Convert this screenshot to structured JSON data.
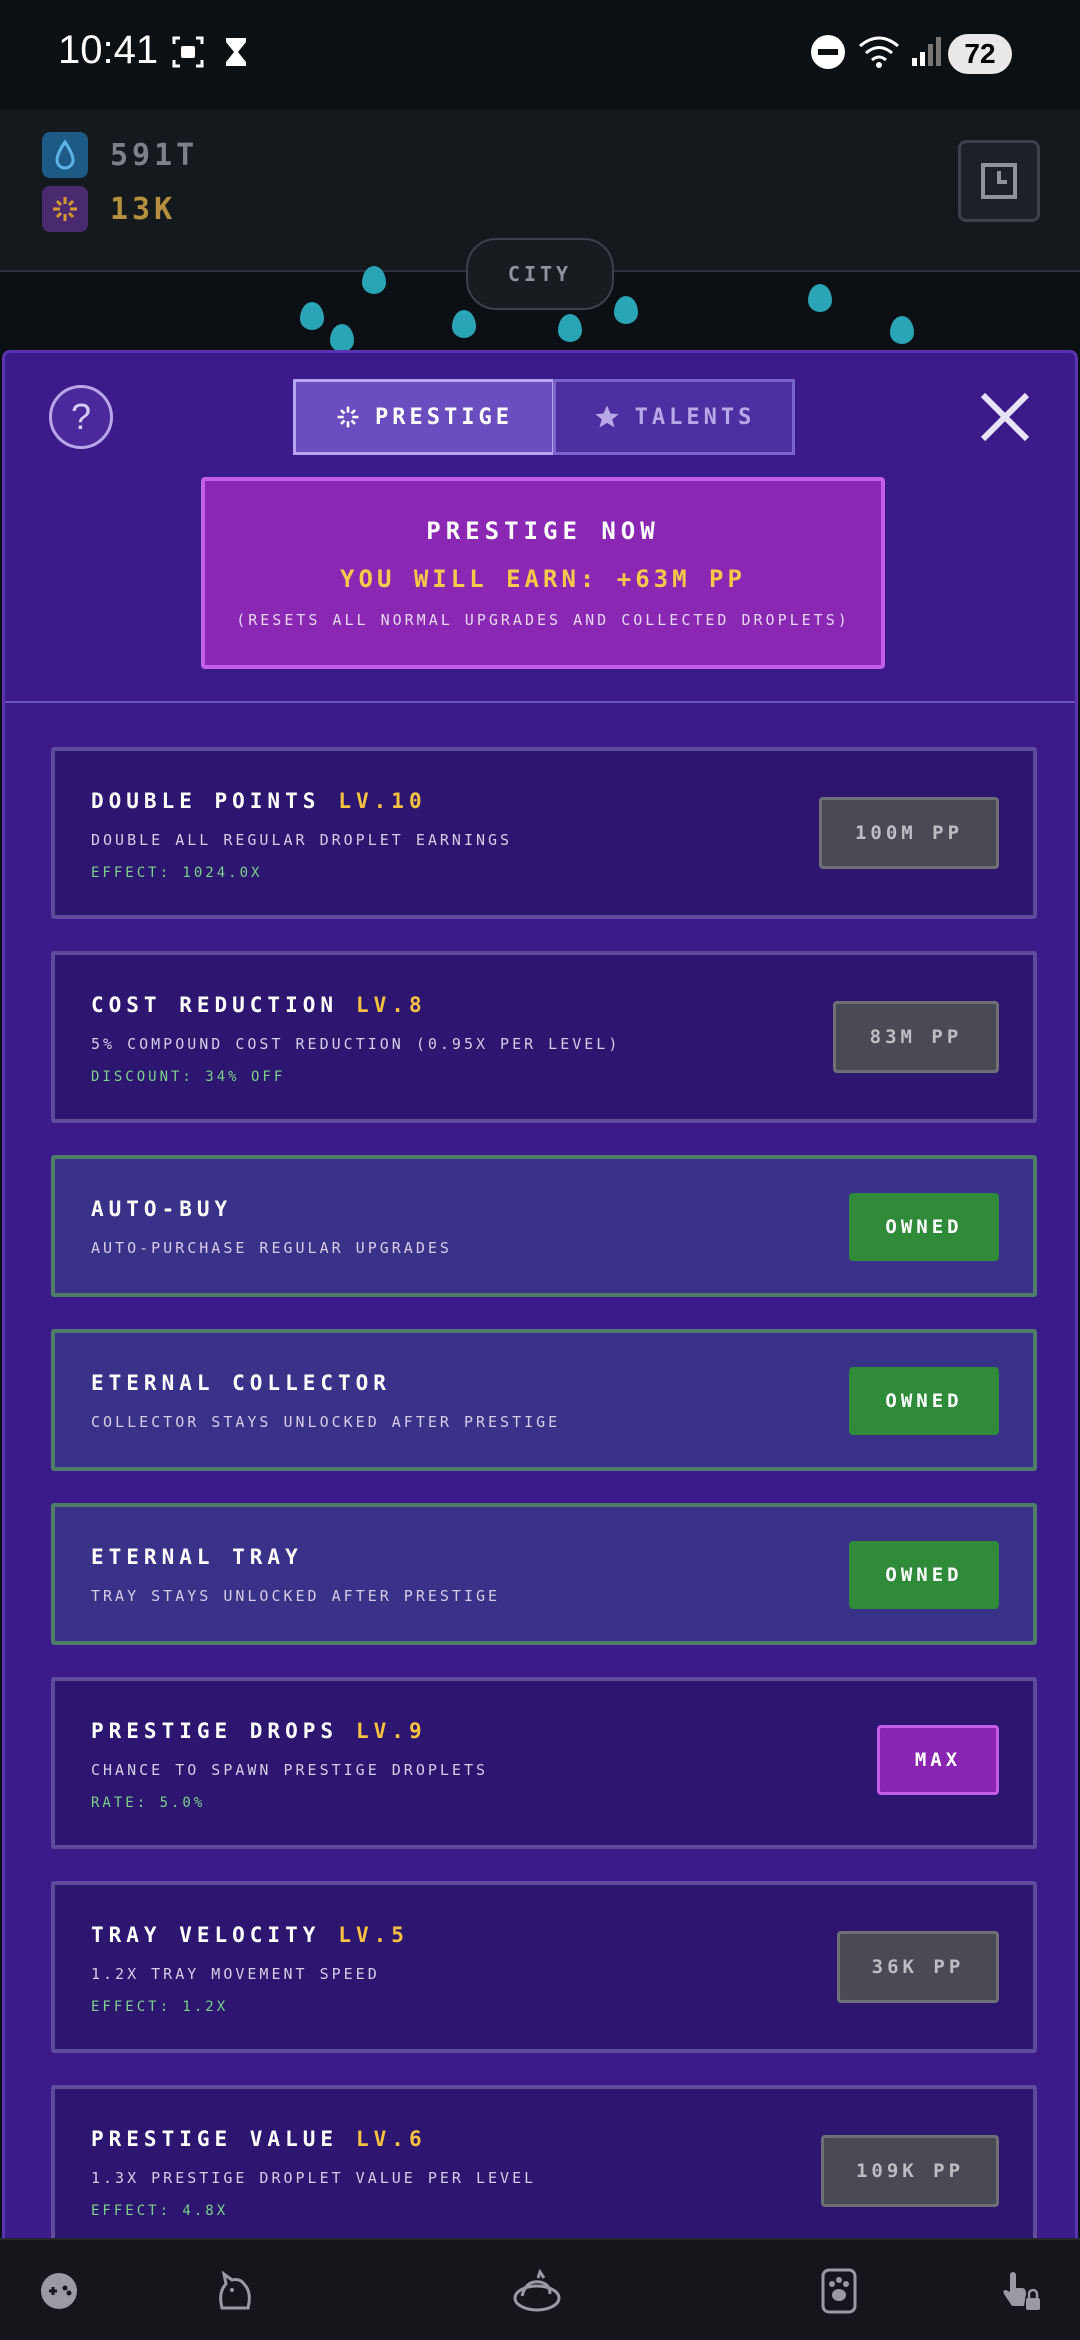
{
  "status_bar": {
    "time": "10:41",
    "battery": "72"
  },
  "header": {
    "currencies": [
      {
        "icon": "droplet-icon",
        "value": "591T",
        "color": "#7d8187"
      },
      {
        "icon": "sparkle-icon",
        "value": "13K",
        "color": "#b49040"
      }
    ],
    "location_tab": "CITY"
  },
  "panel": {
    "tabs": [
      {
        "label": "PRESTIGE",
        "icon": "sparkle-icon",
        "active": true
      },
      {
        "label": "TALENTS",
        "icon": "star-icon",
        "active": false
      }
    ],
    "prestige_box": {
      "title": "PRESTIGE NOW",
      "earn": "YOU WILL EARN: +63M PP",
      "note": "(RESETS ALL NORMAL UPGRADES AND COLLECTED DROPLETS)"
    },
    "upgrades": [
      {
        "title": "DOUBLE POINTS",
        "level": "LV.10",
        "desc": "DOUBLE ALL REGULAR DROPLET EARNINGS",
        "effect": "EFFECT: 1024.0X",
        "button": "100M PP",
        "state": "cost"
      },
      {
        "title": "COST REDUCTION",
        "level": "LV.8",
        "desc": "5% COMPOUND COST REDUCTION (0.95X PER LEVEL)",
        "effect": "DISCOUNT: 34% OFF",
        "button": "83M PP",
        "state": "cost"
      },
      {
        "title": "AUTO-BUY",
        "level": "",
        "desc": "AUTO-PURCHASE REGULAR UPGRADES",
        "effect": "",
        "button": "OWNED",
        "state": "owned"
      },
      {
        "title": "ETERNAL COLLECTOR",
        "level": "",
        "desc": "COLLECTOR STAYS UNLOCKED AFTER PRESTIGE",
        "effect": "",
        "button": "OWNED",
        "state": "owned"
      },
      {
        "title": "ETERNAL TRAY",
        "level": "",
        "desc": "TRAY STAYS UNLOCKED AFTER PRESTIGE",
        "effect": "",
        "button": "OWNED",
        "state": "owned"
      },
      {
        "title": "PRESTIGE DROPS",
        "level": "LV.9",
        "desc": "CHANCE TO SPAWN PRESTIGE DROPLETS",
        "effect": "RATE: 5.0%",
        "button": "MAX",
        "state": "max"
      },
      {
        "title": "TRAY VELOCITY",
        "level": "LV.5",
        "desc": "1.2X TRAY MOVEMENT SPEED",
        "effect": "EFFECT: 1.2X",
        "button": "36K PP",
        "state": "cost"
      },
      {
        "title": "PRESTIGE VALUE",
        "level": "LV.6",
        "desc": "1.3X PRESTIGE DROPLET VALUE PER LEVEL",
        "effect": "EFFECT: 4.8X",
        "button": "109K PP",
        "state": "cost"
      }
    ]
  },
  "bottom_nav": [
    {
      "icon": "gamepad-icon"
    },
    {
      "icon": "cat-icon"
    },
    {
      "icon": "cat-bed-icon"
    },
    {
      "icon": "paw-icon"
    },
    {
      "icon": "locked-pointer-icon"
    }
  ]
}
